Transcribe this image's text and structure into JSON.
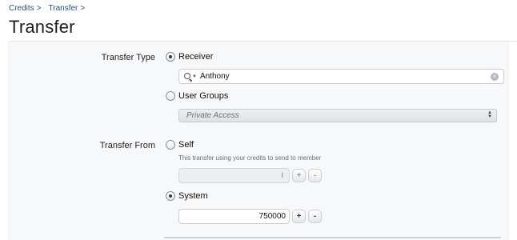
{
  "breadcrumb": {
    "items": [
      {
        "label": "Credits",
        "sep": ">"
      },
      {
        "label": "Transfer",
        "sep": ">"
      }
    ]
  },
  "page": {
    "title": "Transfer"
  },
  "transfer_type": {
    "label": "Transfer Type",
    "options": [
      {
        "label": "Receiver",
        "selected": true
      },
      {
        "label": "User Groups",
        "selected": false
      }
    ],
    "receiver_value": "Anthony",
    "user_group_selected": "Private Access"
  },
  "transfer_from": {
    "label": "Transfer From",
    "self": {
      "label": "Self",
      "selected": false,
      "help": "This transfer using your credits to send to member",
      "amount": ""
    },
    "system": {
      "label": "System",
      "selected": true,
      "amount": "750000"
    },
    "stepper": {
      "plus": "+",
      "minus": "-"
    }
  },
  "icons": {
    "search": "search-icon",
    "clear": "clear-icon",
    "select_arrows": "updown-arrows-icon"
  },
  "colors": {
    "link": "#2b4f7e",
    "panel_bg": "#f7f8fa"
  }
}
